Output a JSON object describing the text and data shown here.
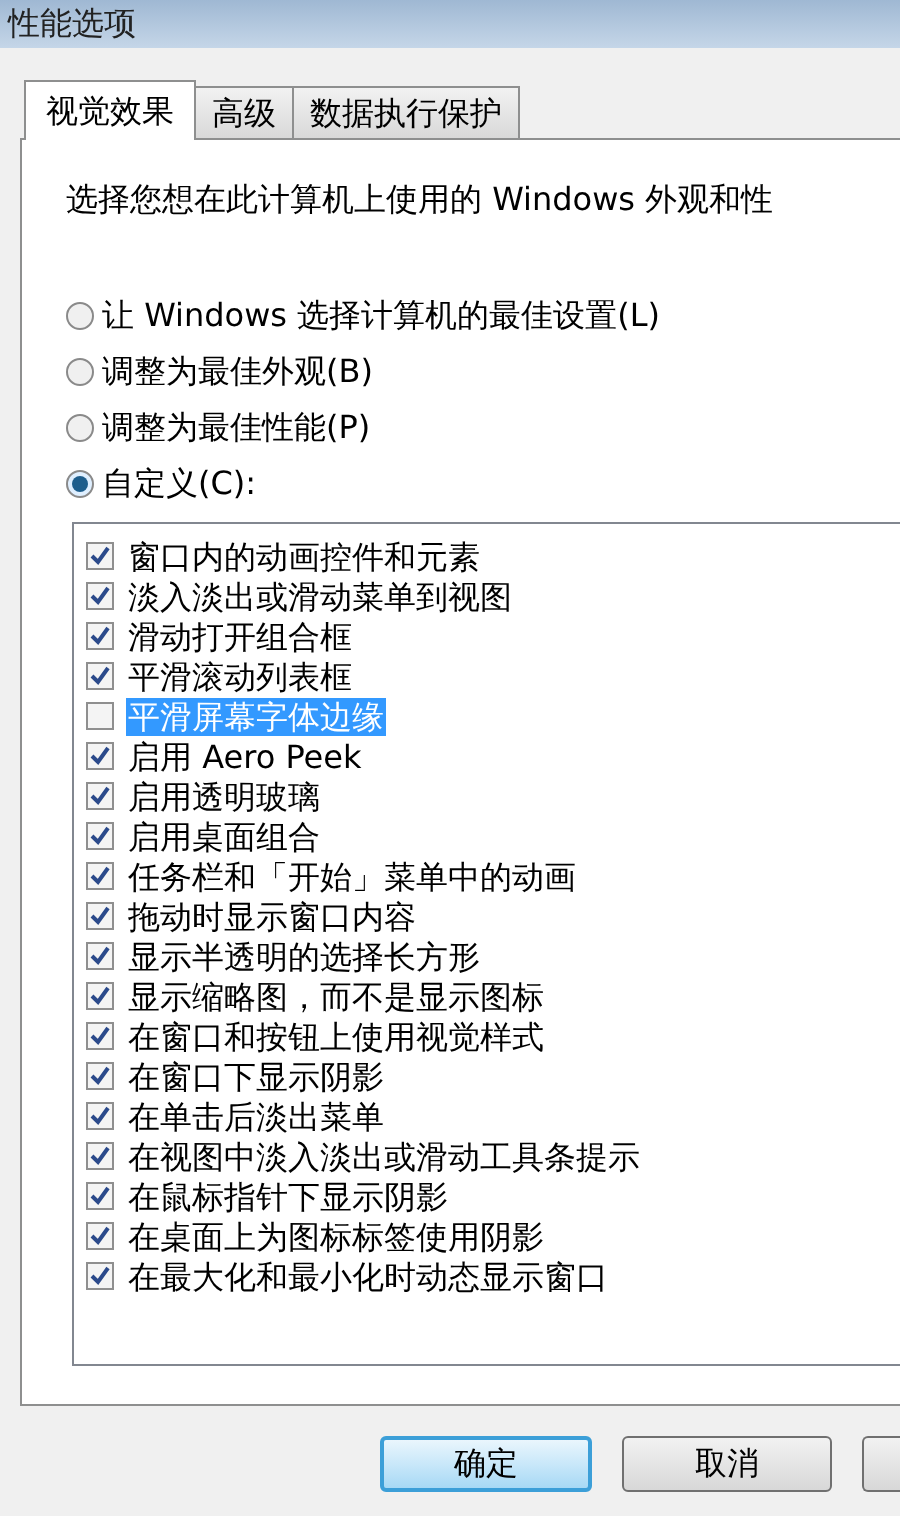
{
  "window": {
    "title": "性能选项"
  },
  "tabs": [
    {
      "label": "视觉效果",
      "selected": true
    },
    {
      "label": "高级",
      "selected": false
    },
    {
      "label": "数据执行保护",
      "selected": false
    }
  ],
  "description": "选择您想在此计算机上使用的 Windows 外观和性",
  "options": [
    {
      "label": "让 Windows 选择计算机的最佳设置(L)",
      "selected": false
    },
    {
      "label": "调整为最佳外观(B)",
      "selected": false
    },
    {
      "label": "调整为最佳性能(P)",
      "selected": false
    },
    {
      "label": "自定义(C):",
      "selected": true
    }
  ],
  "effects": [
    {
      "label": "窗口内的动画控件和元素",
      "checked": true,
      "selected": false
    },
    {
      "label": "淡入淡出或滑动菜单到视图",
      "checked": true,
      "selected": false
    },
    {
      "label": "滑动打开组合框",
      "checked": true,
      "selected": false
    },
    {
      "label": "平滑滚动列表框",
      "checked": true,
      "selected": false
    },
    {
      "label": "平滑屏幕字体边缘",
      "checked": false,
      "selected": true
    },
    {
      "label": "启用 Aero Peek",
      "checked": true,
      "selected": false
    },
    {
      "label": "启用透明玻璃",
      "checked": true,
      "selected": false
    },
    {
      "label": "启用桌面组合",
      "checked": true,
      "selected": false
    },
    {
      "label": "任务栏和「开始」菜单中的动画",
      "checked": true,
      "selected": false
    },
    {
      "label": "拖动时显示窗口内容",
      "checked": true,
      "selected": false
    },
    {
      "label": "显示半透明的选择长方形",
      "checked": true,
      "selected": false
    },
    {
      "label": "显示缩略图，而不是显示图标",
      "checked": true,
      "selected": false
    },
    {
      "label": "在窗口和按钮上使用视觉样式",
      "checked": true,
      "selected": false
    },
    {
      "label": "在窗口下显示阴影",
      "checked": true,
      "selected": false
    },
    {
      "label": "在单击后淡出菜单",
      "checked": true,
      "selected": false
    },
    {
      "label": "在视图中淡入淡出或滑动工具条提示",
      "checked": true,
      "selected": false
    },
    {
      "label": "在鼠标指针下显示阴影",
      "checked": true,
      "selected": false
    },
    {
      "label": "在桌面上为图标标签使用阴影",
      "checked": true,
      "selected": false
    },
    {
      "label": "在最大化和最小化时动态显示窗口",
      "checked": true,
      "selected": false
    }
  ],
  "buttons": [
    {
      "label": "确定",
      "default": true
    },
    {
      "label": "取消",
      "default": false
    }
  ]
}
